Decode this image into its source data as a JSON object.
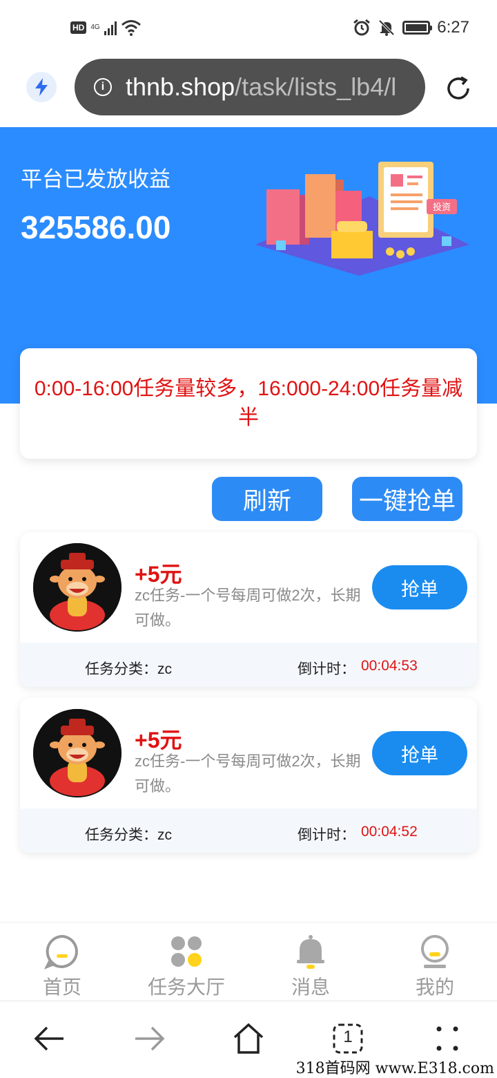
{
  "status_bar": {
    "hd_badge": "HD",
    "network": "4G",
    "time": "6:27"
  },
  "browser": {
    "url_host": "thnb.shop",
    "url_path": "/task/lists_lb4/l"
  },
  "hero": {
    "label": "平台已发放收益",
    "amount": "325586.00",
    "illustration_sign": "投资"
  },
  "notice": {
    "text": "0:00-16:00任务量较多，16:000-24:00任务量减半"
  },
  "actions": {
    "refresh_label": "刷新",
    "grab_all_label": "一键抢单"
  },
  "tasks": [
    {
      "reward": "+5元",
      "description": "zc任务-一个号每周可做2次，长期可做。",
      "grab_label": "抢单",
      "category_label": "任务分类：",
      "category_value": "zc",
      "countdown_label": "倒计时：",
      "countdown_value": "00:04:53"
    },
    {
      "reward": "+5元",
      "description": "zc任务-一个号每周可做2次，长期可做。",
      "grab_label": "抢单",
      "category_label": "任务分类：",
      "category_value": "zc",
      "countdown_label": "倒计时：",
      "countdown_value": "00:04:52"
    }
  ],
  "tabbar": {
    "items": [
      {
        "label": "首页",
        "icon": "home-chat-icon"
      },
      {
        "label": "任务大厅",
        "icon": "task-hall-icon"
      },
      {
        "label": "消息",
        "icon": "bell-icon"
      },
      {
        "label": "我的",
        "icon": "profile-icon"
      }
    ]
  },
  "system_nav": {
    "tab_count": "1"
  },
  "watermark": "318首码网 www.E318.com",
  "colors": {
    "primary_blue": "#2b8cff",
    "alert_red": "#e01212",
    "tab_accent_yellow": "#ffd21e"
  }
}
